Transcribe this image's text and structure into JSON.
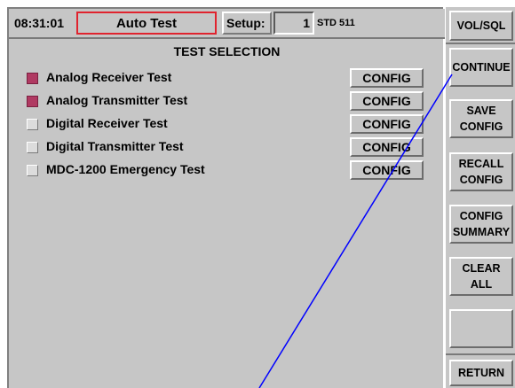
{
  "header": {
    "time": "08:31:01",
    "mode": "Auto Test",
    "setup_label": "Setup:",
    "setup_number": "1",
    "setup_std": "STD 511"
  },
  "section_title": "TEST SELECTION",
  "tests": [
    {
      "label": "Analog Receiver Test",
      "checked": true,
      "config": "CONFIG"
    },
    {
      "label": "Analog Transmitter Test",
      "checked": true,
      "config": "CONFIG"
    },
    {
      "label": "Digital Receiver Test",
      "checked": false,
      "config": "CONFIG"
    },
    {
      "label": "Digital Transmitter Test",
      "checked": false,
      "config": "CONFIG"
    },
    {
      "label": "MDC-1200 Emergency Test",
      "checked": false,
      "config": "CONFIG"
    }
  ],
  "softkeys": {
    "vol_sql": "VOL/SQL",
    "continue": "CONTINUE",
    "save_1": "SAVE",
    "save_2": "CONFIG",
    "recall_1": "RECALL",
    "recall_2": "CONFIG",
    "summary_1": "CONFIG",
    "summary_2": "SUMMARY",
    "clear_1": "CLEAR",
    "clear_2": "ALL",
    "blank": "",
    "return": "RETURN"
  },
  "colors": {
    "mode_border": "#e0232e",
    "checkbox_checked": "#b03a62",
    "panel": "#c6c6c6",
    "pointer_line": "#0000ff"
  }
}
